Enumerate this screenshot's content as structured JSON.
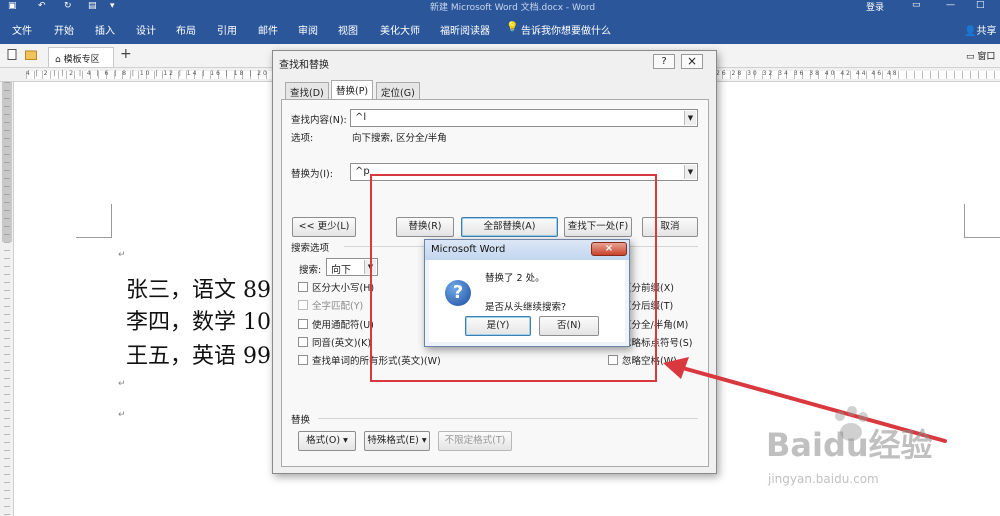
{
  "titlebar": {
    "title": "新建 Microsoft Word 文档.docx - Word",
    "login": "登录"
  },
  "ribbon": {
    "tabs": [
      "文件",
      "开始",
      "插入",
      "设计",
      "布局",
      "引用",
      "邮件",
      "审阅",
      "视图",
      "美化大师",
      "福昕阅读器"
    ],
    "tellme": "告诉我你想要做什么",
    "share": "共享"
  },
  "docbar": {
    "tab_label": "模板专区",
    "right_label": "窗口"
  },
  "ruler": {
    "left_nums": "4 | 2 | | 2 | 4 | 6 | 8 | 10 | 12 | 14 | 16 | 18 | 20 | 22",
    "right_nums": "26 28 30 32 34 36 38 40 42 44 46 48"
  },
  "document": {
    "line1": "张三，语文 89",
    "line2": "李四，数学 100",
    "line3": "王五，英语 99",
    "para_mark": "↵"
  },
  "dialog": {
    "title": "查找和替换",
    "help": "?",
    "close": "×",
    "tabs": [
      "查找(D)",
      "替换(P)",
      "定位(G)"
    ],
    "find_label": "查找内容(N):",
    "find_value": "^l",
    "options_label": "选项:",
    "options_value": "向下搜索, 区分全/半角",
    "replace_label": "替换为(I):",
    "replace_value": "^p",
    "less_button": "<< 更少(L)",
    "replace_button": "替换(R)",
    "replace_all_button": "全部替换(A)",
    "find_next_button": "查找下一处(F)",
    "cancel_button": "取消",
    "search_options_title": "搜索选项",
    "search_label": "搜索:",
    "search_value": "向下",
    "options_left": [
      {
        "label": "区分大小写(H)",
        "enabled": true
      },
      {
        "label": "全字匹配(Y)",
        "enabled": false
      },
      {
        "label": "使用通配符(U)",
        "enabled": true
      },
      {
        "label": "同音(英文)(K)",
        "enabled": true
      },
      {
        "label": "查找单词的所有形式(英文)(W)",
        "enabled": true
      }
    ],
    "options_right": [
      {
        "label": "区分前缀(X)"
      },
      {
        "label": "区分后缀(T)"
      },
      {
        "label": "区分全/半角(M)"
      },
      {
        "label": "忽略标点符号(S)"
      },
      {
        "label": "忽略空格(W)"
      }
    ],
    "replace_section_title": "替换",
    "format_button": "格式(O) ▾",
    "special_button": "特殊格式(E) ▾",
    "no_format_button": "不限定格式(T)"
  },
  "messagebox": {
    "title": "Microsoft Word",
    "close": "×",
    "icon": "?",
    "line1": "替换了 2 处。",
    "line2": "是否从头继续搜索?",
    "yes_button": "是(Y)",
    "no_button": "否(N)"
  },
  "watermark": {
    "text": "Baidu经验",
    "sub": "jingyan.baidu.com"
  },
  "colors": {
    "ribbon": "#2b579a",
    "annotation": "#d9383e"
  }
}
